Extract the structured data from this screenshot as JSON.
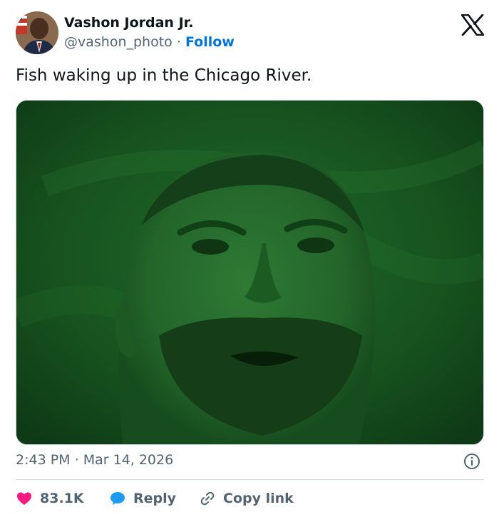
{
  "author": {
    "name": "Vashon Jordan Jr.",
    "handle": "@vashon_photo",
    "separator": "·",
    "follow_label": "Follow"
  },
  "platform_icon": "x-logo-icon",
  "tweet": {
    "text": "Fish waking up in the Chicago River."
  },
  "media": {
    "description_icon": "video-still",
    "tint_color": "#1b5e20"
  },
  "meta": {
    "time": "2:43 PM",
    "separator": "·",
    "date": "Mar 14, 2026",
    "info_icon": "info-icon"
  },
  "actions": {
    "like_count": "83.1K",
    "like_icon": "heart-icon",
    "like_color": "#f91880",
    "reply_label": "Reply",
    "reply_icon": "speech-bubble-icon",
    "reply_color": "#1d9bf0",
    "copy_label": "Copy link",
    "copy_icon": "link-icon"
  }
}
